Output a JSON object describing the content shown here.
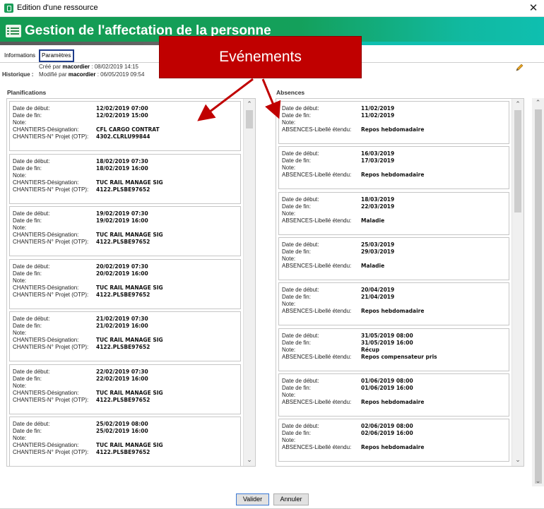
{
  "window": {
    "title": "Edition d'une ressource",
    "close_glyph": "✕"
  },
  "header": {
    "title": "Gestion de l'affectation de la personne"
  },
  "tabs": [
    {
      "label": "Informations"
    },
    {
      "label": "Paramètres"
    }
  ],
  "history": {
    "label": "Historique :",
    "created_prefix": "Créé par ",
    "created_by": "macordier",
    "created_at": " : 08/02/2019 14:15",
    "modified_prefix": "Modifié par ",
    "modified_by": "macordier",
    "modified_at": " : 06/05/2019 09:54"
  },
  "callout": {
    "label": "Evénements",
    "color": "#c00000"
  },
  "planifications": {
    "title": "Planifications",
    "labels": {
      "start": "Date de début:",
      "end": "Date de fin:",
      "note": "Note:",
      "designation": "CHANTIERS-Désignation:",
      "project": "CHANTIERS-N° Projet (OTP):"
    },
    "items": [
      {
        "start": "12/02/2019 07:00",
        "end": "12/02/2019 15:00",
        "designation": "CFL CARGO CONTRAT",
        "project": "4302.CLRLU99844"
      },
      {
        "start": "18/02/2019 07:30",
        "end": "18/02/2019 16:00",
        "designation": "TUC RAIL MANAGE SIG",
        "project": "4122.PLSBE97652"
      },
      {
        "start": "19/02/2019 07:30",
        "end": "19/02/2019 16:00",
        "designation": "TUC RAIL MANAGE SIG",
        "project": "4122.PLSBE97652"
      },
      {
        "start": "20/02/2019 07:30",
        "end": "20/02/2019 16:00",
        "designation": "TUC RAIL MANAGE SIG",
        "project": "4122.PLSBE97652"
      },
      {
        "start": "21/02/2019 07:30",
        "end": "21/02/2019 16:00",
        "designation": "TUC RAIL MANAGE SIG",
        "project": "4122.PLSBE97652"
      },
      {
        "start": "22/02/2019 07:30",
        "end": "22/02/2019 16:00",
        "designation": "TUC RAIL MANAGE SIG",
        "project": "4122.PLSBE97652"
      },
      {
        "start": "25/02/2019 08:00",
        "end": "25/02/2019 16:00",
        "designation": "TUC RAIL MANAGE SIG",
        "project": "4122.PLSBE97652"
      }
    ]
  },
  "absences": {
    "title": "Absences",
    "labels": {
      "start": "Date de début:",
      "end": "Date de fin:",
      "note": "Note:",
      "label": "ABSENCES-Libellé étendu:"
    },
    "items": [
      {
        "start": "11/02/2019",
        "end": "11/02/2019",
        "note": "",
        "label": "Repos hebdomadaire"
      },
      {
        "start": "16/03/2019",
        "end": "17/03/2019",
        "note": "",
        "label": "Repos hebdomadaire"
      },
      {
        "start": "18/03/2019",
        "end": "22/03/2019",
        "note": "",
        "label": "Maladie"
      },
      {
        "start": "25/03/2019",
        "end": "29/03/2019",
        "note": "",
        "label": "Maladie"
      },
      {
        "start": "20/04/2019",
        "end": "21/04/2019",
        "note": "",
        "label": "Repos hebdomadaire"
      },
      {
        "start": "31/05/2019 08:00",
        "end": "31/05/2019 16:00",
        "note": "Récup",
        "label": "Repos compensateur pris"
      },
      {
        "start": "01/06/2019 08:00",
        "end": "01/06/2019 16:00",
        "note": "",
        "label": "Repos hebdomadaire"
      },
      {
        "start": "02/06/2019 08:00",
        "end": "02/06/2019 16:00",
        "note": "",
        "label": "Repos hebdomadaire"
      }
    ]
  },
  "buttons": {
    "ok": "Valider",
    "cancel": "Annuler"
  }
}
